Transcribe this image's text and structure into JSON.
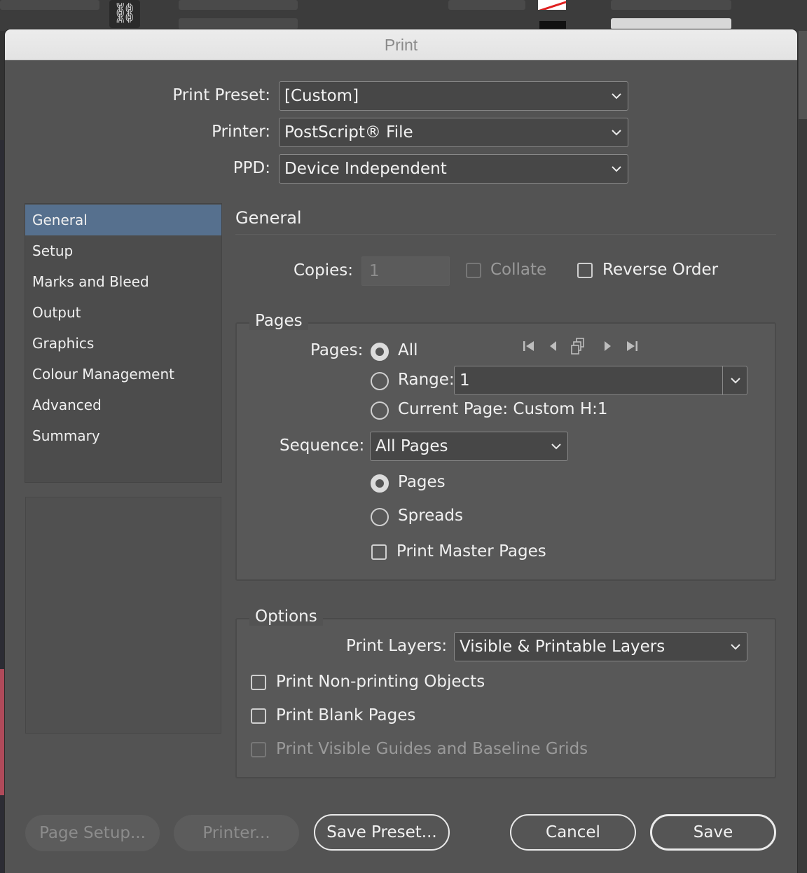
{
  "dialog": {
    "title": "Print"
  },
  "background": {
    "link_glyph": "⛓"
  },
  "preset": {
    "print_preset_label": "Print Preset:",
    "print_preset_value": "[Custom]",
    "printer_label": "Printer:",
    "printer_value": "PostScript® File",
    "ppd_label": "PPD:",
    "ppd_value": "Device Independent"
  },
  "sidebar": {
    "items": [
      {
        "label": "General",
        "active": true
      },
      {
        "label": "Setup"
      },
      {
        "label": "Marks and Bleed"
      },
      {
        "label": "Output"
      },
      {
        "label": "Graphics"
      },
      {
        "label": "Colour Management"
      },
      {
        "label": "Advanced"
      },
      {
        "label": "Summary"
      }
    ]
  },
  "general": {
    "title": "General",
    "copies_label": "Copies:",
    "copies_value": "1",
    "collate_label": "Collate",
    "collate_checked": false,
    "reverse_order_label": "Reverse Order",
    "reverse_order_checked": false
  },
  "pages": {
    "legend": "Pages",
    "pages_label": "Pages:",
    "all_label": "All",
    "range_label": "Range:",
    "range_value": "1",
    "current_page_label": "Current Page: Custom H:1",
    "selected": "All",
    "sequence_label": "Sequence:",
    "sequence_value": "All Pages",
    "layout_pages_label": "Pages",
    "layout_spreads_label": "Spreads",
    "layout_selected": "Pages",
    "print_master_pages_label": "Print Master Pages",
    "print_master_pages_checked": false,
    "nav_icons": [
      "first-page-icon",
      "previous-page-icon",
      "pages-icon",
      "next-page-icon",
      "last-page-icon"
    ]
  },
  "options": {
    "legend": "Options",
    "print_layers_label": "Print Layers:",
    "print_layers_value": "Visible & Printable Layers",
    "non_printing_label": "Print Non-printing Objects",
    "blank_pages_label": "Print Blank Pages",
    "guides_label": "Print Visible Guides and Baseline Grids"
  },
  "buttons": {
    "page_setup": "Page Setup...",
    "printer": "Printer...",
    "save_preset": "Save Preset...",
    "cancel": "Cancel",
    "save": "Save"
  },
  "colors": {
    "dialog_bg": "#535353",
    "sidebar_selected": "#56708e",
    "text": "#f0f0f0",
    "disabled_text": "#8c8c8c"
  }
}
